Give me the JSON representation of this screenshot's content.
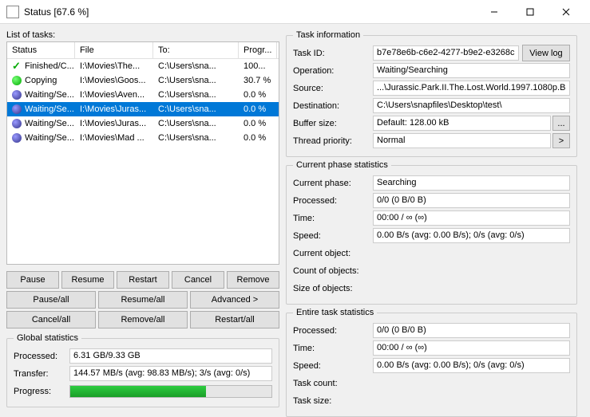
{
  "window": {
    "title": "Status [67.6 %]"
  },
  "listLabel": "List of tasks:",
  "columns": {
    "status": "Status",
    "file": "File",
    "to": "To:",
    "prog": "Progr..."
  },
  "tasks": [
    {
      "status": "Finished/C...",
      "file": "I:\\Movies\\The...",
      "to": "C:\\Users\\sna...",
      "prog": "100...",
      "icon": "done"
    },
    {
      "status": "Copying",
      "file": "I:\\Movies\\Goos...",
      "to": "C:\\Users\\sna...",
      "prog": "30.7 %",
      "icon": "copy"
    },
    {
      "status": "Waiting/Se...",
      "file": "I:\\Movies\\Aven...",
      "to": "C:\\Users\\sna...",
      "prog": "0.0 %",
      "icon": "wait"
    },
    {
      "status": "Waiting/Se...",
      "file": "I:\\Movies\\Juras...",
      "to": "C:\\Users\\sna...",
      "prog": "0.0 %",
      "icon": "wait",
      "selected": true
    },
    {
      "status": "Waiting/Se...",
      "file": "I:\\Movies\\Juras...",
      "to": "C:\\Users\\sna...",
      "prog": "0.0 %",
      "icon": "wait"
    },
    {
      "status": "Waiting/Se...",
      "file": "I:\\Movies\\Mad ...",
      "to": "C:\\Users\\sna...",
      "prog": "0.0 %",
      "icon": "wait"
    }
  ],
  "buttons": {
    "pause": "Pause",
    "resume": "Resume",
    "restart": "Restart",
    "cancel": "Cancel",
    "remove": "Remove",
    "pauseAll": "Pause/all",
    "resumeAll": "Resume/all",
    "advanced": "Advanced >",
    "cancelAll": "Cancel/all",
    "removeAll": "Remove/all",
    "restartAll": "Restart/all"
  },
  "global": {
    "legend": "Global statistics",
    "processedLabel": "Processed:",
    "processed": "6.31 GB/9.33 GB",
    "transferLabel": "Transfer:",
    "transfer": "144.57 MB/s (avg: 98.83 MB/s); 3/s (avg: 0/s)",
    "progressLabel": "Progress:",
    "progressPct": 67.6
  },
  "taskInfo": {
    "legend": "Task information",
    "taskIdLabel": "Task ID:",
    "taskId": "b7e78e6b-c6e2-4277-b9e2-e3268c",
    "viewLog": "View log",
    "operationLabel": "Operation:",
    "operation": "Waiting/Searching",
    "sourceLabel": "Source:",
    "source": "...\\Jurassic.Park.II.The.Lost.World.1997.1080p.B",
    "destLabel": "Destination:",
    "dest": "C:\\Users\\snapfiles\\Desktop\\test\\",
    "bufferLabel": "Buffer size:",
    "buffer": "Default: 128.00 kB",
    "bufferBtn": "...",
    "priorityLabel": "Thread priority:",
    "priority": "Normal",
    "priorityBtn": ">"
  },
  "phase": {
    "legend": "Current phase statistics",
    "phaseLabel": "Current phase:",
    "phase": "Searching",
    "processedLabel": "Processed:",
    "processed": "0/0 (0 B/0 B)",
    "timeLabel": "Time:",
    "time": "00:00 / ∞ (∞)",
    "speedLabel": "Speed:",
    "speed": "0.00 B/s (avg: 0.00 B/s); 0/s (avg: 0/s)",
    "curObjLabel": "Current object:",
    "curObj": "",
    "countLabel": "Count of objects:",
    "count": "",
    "sizeLabel": "Size of objects:",
    "size": ""
  },
  "entire": {
    "legend": "Entire task statistics",
    "processedLabel": "Processed:",
    "processed": "0/0 (0 B/0 B)",
    "timeLabel": "Time:",
    "time": "00:00 / ∞ (∞)",
    "speedLabel": "Speed:",
    "speed": "0.00 B/s (avg: 0.00 B/s); 0/s (avg: 0/s)",
    "taskCountLabel": "Task count:",
    "taskCount": "",
    "taskSizeLabel": "Task size:",
    "taskSize": ""
  }
}
